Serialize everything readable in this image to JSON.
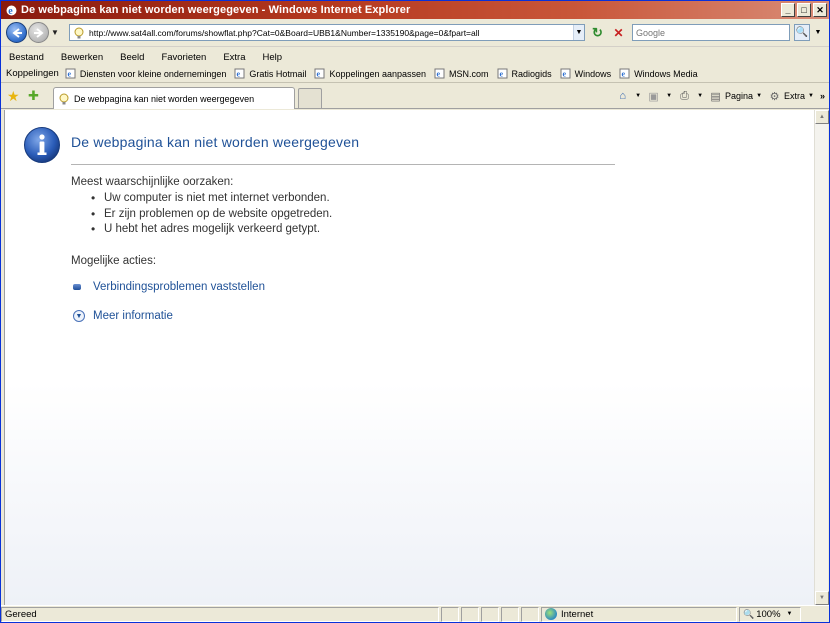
{
  "window": {
    "title": "De webpagina kan niet worden weergegeven - Windows Internet Explorer",
    "controls": {
      "minimize": "_",
      "maximize": "□",
      "close": "✕"
    }
  },
  "address": {
    "url": "http://www.sat4all.com/forums/showflat.php?Cat=0&Board=UBB1&Number=1335190&page=0&fpart=all",
    "search_placeholder": "Google"
  },
  "menu": [
    "Bestand",
    "Bewerken",
    "Beeld",
    "Favorieten",
    "Extra",
    "Help"
  ],
  "links_bar": {
    "label": "Koppelingen",
    "items": [
      "Diensten voor kleine ondernemingen",
      "Gratis Hotmail",
      "Koppelingen aanpassen",
      "MSN.com",
      "Radiogids",
      "Windows",
      "Windows Media"
    ]
  },
  "tab": {
    "title": "De webpagina kan niet worden weergegeven"
  },
  "command_bar": {
    "page": "Pagina",
    "tools": "Extra"
  },
  "content": {
    "title": "De webpagina kan niet worden weergegeven",
    "causes_heading": "Meest waarschijnlijke oorzaken:",
    "causes": [
      "Uw computer is niet met internet verbonden.",
      "Er zijn problemen op de website opgetreden.",
      "U hebt het adres mogelijk verkeerd getypt."
    ],
    "actions_heading": "Mogelijke acties:",
    "action_diagnose": "Verbindingsproblemen vaststellen",
    "action_more": "Meer informatie"
  },
  "status": {
    "text": "Gereed",
    "zone": "Internet",
    "zoom": "100%"
  }
}
